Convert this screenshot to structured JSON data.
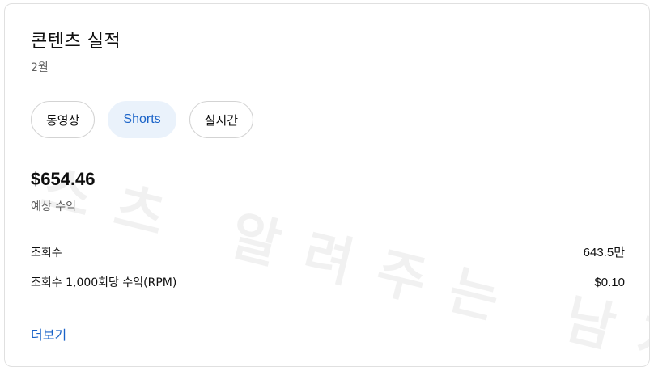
{
  "card": {
    "title": "콘텐츠 실적",
    "period": "2월"
  },
  "tabs": [
    {
      "label": "동영상",
      "active": false
    },
    {
      "label": "Shorts",
      "active": true
    },
    {
      "label": "실시간",
      "active": false
    }
  ],
  "revenue": {
    "amount": "$654.46",
    "label": "예상 수익"
  },
  "metrics": [
    {
      "label": "조회수",
      "value": "643.5만"
    },
    {
      "label": "조회수 1,000회당 수익(RPM)",
      "value": "$0.10"
    }
  ],
  "more_link": "더보기",
  "watermark": "스츠 알려주는 남자",
  "colors": {
    "accent": "#1a63c8",
    "active_chip_bg": "#eaf2fb",
    "muted_text": "#606060",
    "border": "#e0e0e0"
  }
}
